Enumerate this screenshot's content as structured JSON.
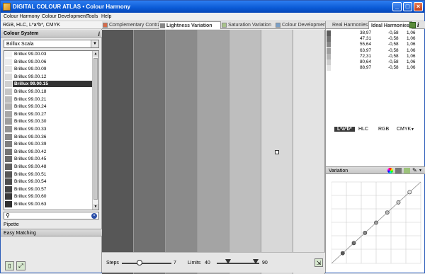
{
  "window": {
    "title": "DIGITAL COLOUR ATLAS • Colour Harmony",
    "buttons": {
      "minimize": "_",
      "maximize": "□",
      "close": "×"
    }
  },
  "menu": [
    "Colour Harmony",
    "Colour Development",
    "Tools",
    "Help"
  ],
  "left": {
    "mode_label": "RGB, HLC, L*a*b*, CMYK",
    "colour_system_title": "Colour System",
    "info_label": "i",
    "scale_select": "Brillux Scala",
    "colour_list": [
      {
        "label": "Brillux 99.00.03",
        "color": "#f4f4f4"
      },
      {
        "label": "Brillux 99.00.06",
        "color": "#ececec"
      },
      {
        "label": "Brillux 99.00.09",
        "color": "#e4e4e4"
      },
      {
        "label": "Brillux 99.00.12",
        "color": "#dadada"
      },
      {
        "label": "Brillux 99.00.15",
        "color": "#d0d0d0",
        "selected": true
      },
      {
        "label": "Brillux 99.00.18",
        "color": "#c6c6c6"
      },
      {
        "label": "Brillux 99.00.21",
        "color": "#bcbcbc"
      },
      {
        "label": "Brillux 99.00.24",
        "color": "#b2b2b2"
      },
      {
        "label": "Brillux 99.00.27",
        "color": "#a8a8a8"
      },
      {
        "label": "Brillux 99.00.30",
        "color": "#9e9e9e"
      },
      {
        "label": "Brillux 99.00.33",
        "color": "#949494"
      },
      {
        "label": "Brillux 99.00.36",
        "color": "#8a8a8a"
      },
      {
        "label": "Brillux 99.00.39",
        "color": "#808080"
      },
      {
        "label": "Brillux 99.00.42",
        "color": "#767676"
      },
      {
        "label": "Brillux 99.00.45",
        "color": "#6c6c6c"
      },
      {
        "label": "Brillux 99.00.48",
        "color": "#626262"
      },
      {
        "label": "Brillux 99.00.51",
        "color": "#585858"
      },
      {
        "label": "Brillux 99.00.54",
        "color": "#4e4e4e"
      },
      {
        "label": "Brillux 99.00.57",
        "color": "#444444"
      },
      {
        "label": "Brillux 99.00.60",
        "color": "#3a3a3a"
      },
      {
        "label": "Brillux 99.00.63",
        "color": "#303030"
      }
    ],
    "search_value": "",
    "pipette_label": "Pipette",
    "easy_matching_label": "Easy Matching"
  },
  "center": {
    "tabs": [
      {
        "label": "Complementary Contrast",
        "icon_color": "#d86b4a"
      },
      {
        "label": "Lightness Variation",
        "icon_color": "#888888",
        "active": true
      },
      {
        "label": "Saturation Variation",
        "icon_color": "#a8c48a"
      },
      {
        "label": "Colour Development",
        "icon_color": "#7aa0c8"
      }
    ],
    "stripes": [
      "#575757",
      "#717171",
      "#8b8b8b",
      "#a4a4a4",
      "#bebebe",
      "#d8d8d8",
      "#e3e3e3"
    ],
    "steps_label": "Steps",
    "steps_value": "7",
    "steps_fraction": 0.35,
    "limits_label": "Limits",
    "limits_min": "40",
    "limits_max": "90"
  },
  "right": {
    "tabs": [
      {
        "label": "Real Harmonies"
      },
      {
        "label": "Ideal Harmonies",
        "active": true
      }
    ],
    "harmony_rows": [
      {
        "l": "38,97",
        "a": "-0,58",
        "b": "1,06",
        "color": "#5a5a5a"
      },
      {
        "l": "47,31",
        "a": "-0,58",
        "b": "1,06",
        "color": "#707070"
      },
      {
        "l": "55,64",
        "a": "-0,58",
        "b": "1,06",
        "color": "#878787"
      },
      {
        "l": "63,97",
        "a": "-0,58",
        "b": "1,06",
        "color": "#9e9e9e"
      },
      {
        "l": "72,31",
        "a": "-0,58",
        "b": "1,06",
        "color": "#b5b5b5"
      },
      {
        "l": "80,64",
        "a": "-0,58",
        "b": "1,06",
        "color": "#cdcdcd"
      },
      {
        "l": "88,97",
        "a": "-0,58",
        "b": "1,06",
        "color": "#e4e4e4"
      }
    ],
    "space_tabs": [
      "L*a*b*",
      "HLC",
      "RGB",
      "CMYK"
    ],
    "variation_label": "Variation"
  }
}
